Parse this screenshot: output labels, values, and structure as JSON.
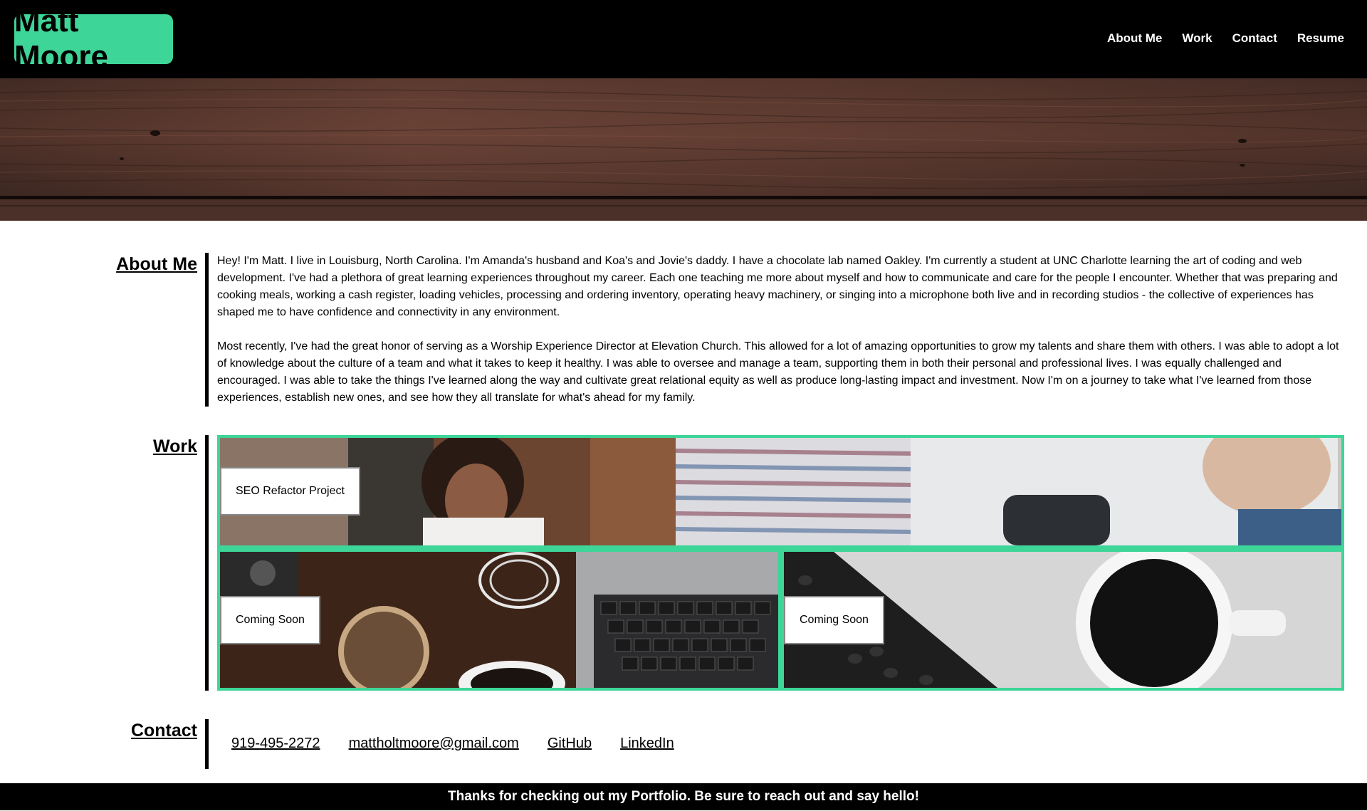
{
  "header": {
    "logo": "Matt Moore",
    "nav": [
      "About Me",
      "Work",
      "Contact",
      "Resume"
    ]
  },
  "about": {
    "title": "About Me",
    "paragraphs": [
      "Hey! I'm Matt. I live in Louisburg, North Carolina. I'm Amanda's husband and Koa's and Jovie's daddy. I have a chocolate lab named Oakley. I'm currently a student at UNC Charlotte learning the art of coding and web development. I've had a plethora of great learning experiences throughout my career. Each one teaching me more about myself and how to communicate and care for the people I encounter. Whether that was preparing and cooking meals, working a cash register, loading vehicles, processing and ordering inventory, operating heavy machinery, or singing into a microphone both live and in recording studios - the collective of experiences has shaped me to have confidence and connectivity in any environment.",
      "Most recently, I've had the great honor of serving as a Worship Experience Director at Elevation Church. This allowed for a lot of amazing opportunities to grow my talents and share them with others. I was able to adopt a lot of knowledge about the culture of a team and what it takes to keep it healthy. I was able to oversee and manage a team, supporting them in both their personal and professional lives. I was equally challenged and encouraged. I was able to take the things I've learned along the way and cultivate great relational equity as well as produce long-lasting impact and investment. Now I'm on a journey to take what I've learned from those experiences, establish new ones, and see how they all translate for what's ahead for my family."
    ]
  },
  "work": {
    "title": "Work",
    "projects": [
      {
        "label": "SEO Refactor Project"
      },
      {
        "label": "Coming Soon"
      },
      {
        "label": "Coming Soon"
      }
    ]
  },
  "contact": {
    "title": "Contact",
    "links": [
      "919-495-2272",
      "mattholtmoore@gmail.com",
      "GitHub",
      "LinkedIn"
    ]
  },
  "footer": {
    "text": "Thanks for checking out my Portfolio. Be sure to reach out and say hello!"
  },
  "colors": {
    "accent": "#3ed598",
    "header_bg": "#000000"
  }
}
